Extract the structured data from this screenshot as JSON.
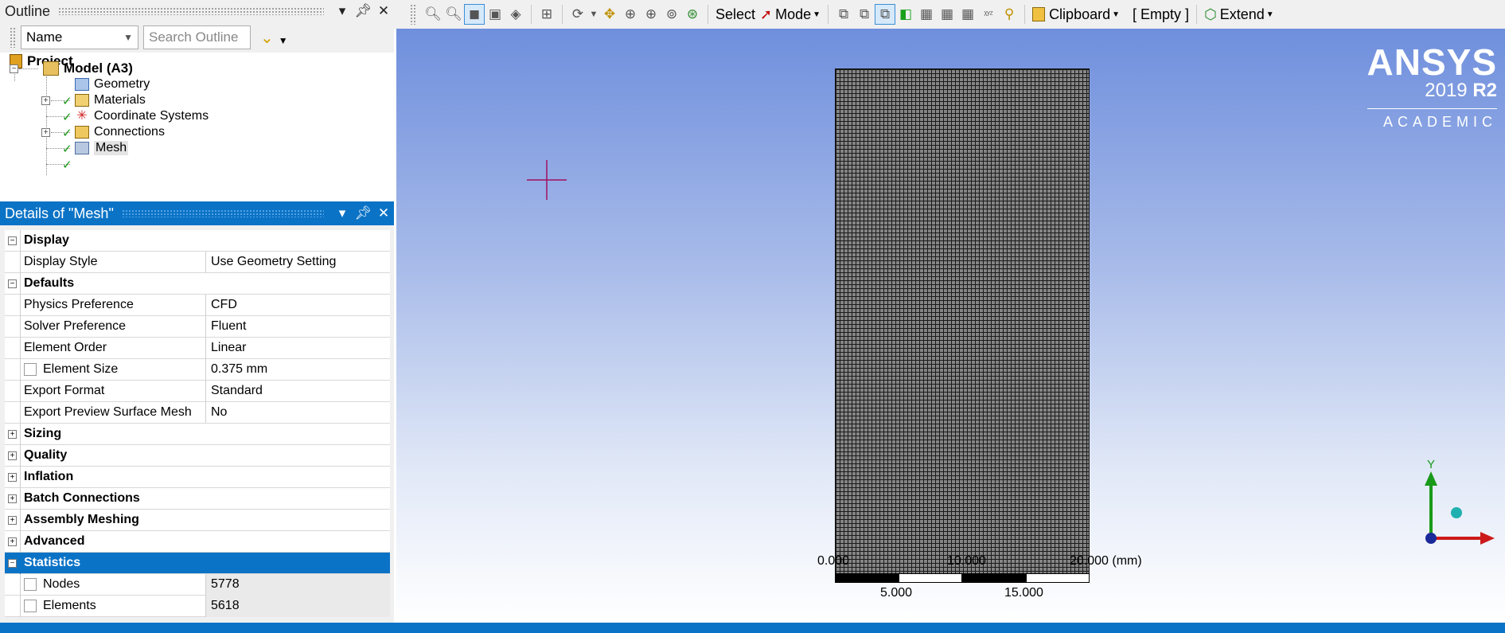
{
  "outline": {
    "title": "Outline",
    "filter_label": "Name",
    "search_placeholder": "Search Outline",
    "tree": {
      "project": "Project",
      "model": "Model (A3)",
      "geometry": "Geometry",
      "materials": "Materials",
      "coordinate_systems": "Coordinate Systems",
      "connections": "Connections",
      "mesh": "Mesh"
    }
  },
  "details": {
    "title": "Details of \"Mesh\"",
    "rows": {
      "display": "Display",
      "display_style_label": "Display Style",
      "display_style_value": "Use Geometry Setting",
      "defaults": "Defaults",
      "physics_label": "Physics Preference",
      "physics_value": "CFD",
      "solver_label": "Solver Preference",
      "solver_value": "Fluent",
      "order_label": "Element Order",
      "order_value": "Linear",
      "size_label": "Element Size",
      "size_value": "0.375 mm",
      "export_label": "Export Format",
      "export_value": "Standard",
      "preview_label": "Export Preview Surface Mesh",
      "preview_value": "No",
      "sizing": "Sizing",
      "quality": "Quality",
      "inflation": "Inflation",
      "batch": "Batch Connections",
      "assembly": "Assembly Meshing",
      "advanced": "Advanced",
      "statistics": "Statistics",
      "nodes_label": "Nodes",
      "nodes_value": "5778",
      "elements_label": "Elements",
      "elements_value": "5618"
    }
  },
  "toolbar": {
    "select": "Select",
    "mode": "Mode",
    "clipboard": "Clipboard",
    "empty": "[ Empty ]",
    "extend": "Extend"
  },
  "viewport": {
    "logo_brand": "ANSYS",
    "logo_year": "2019",
    "logo_release": "R2",
    "logo_edition": "ACADEMIC",
    "scale_top_0": "0.000",
    "scale_top_1": "10.000",
    "scale_top_2": "20.000 (mm)",
    "scale_bot_1": "5.000",
    "scale_bot_2": "15.000",
    "axis_y": "Y"
  },
  "colors": {
    "accent": "#0b73c6",
    "check": "#1a9a1a"
  }
}
